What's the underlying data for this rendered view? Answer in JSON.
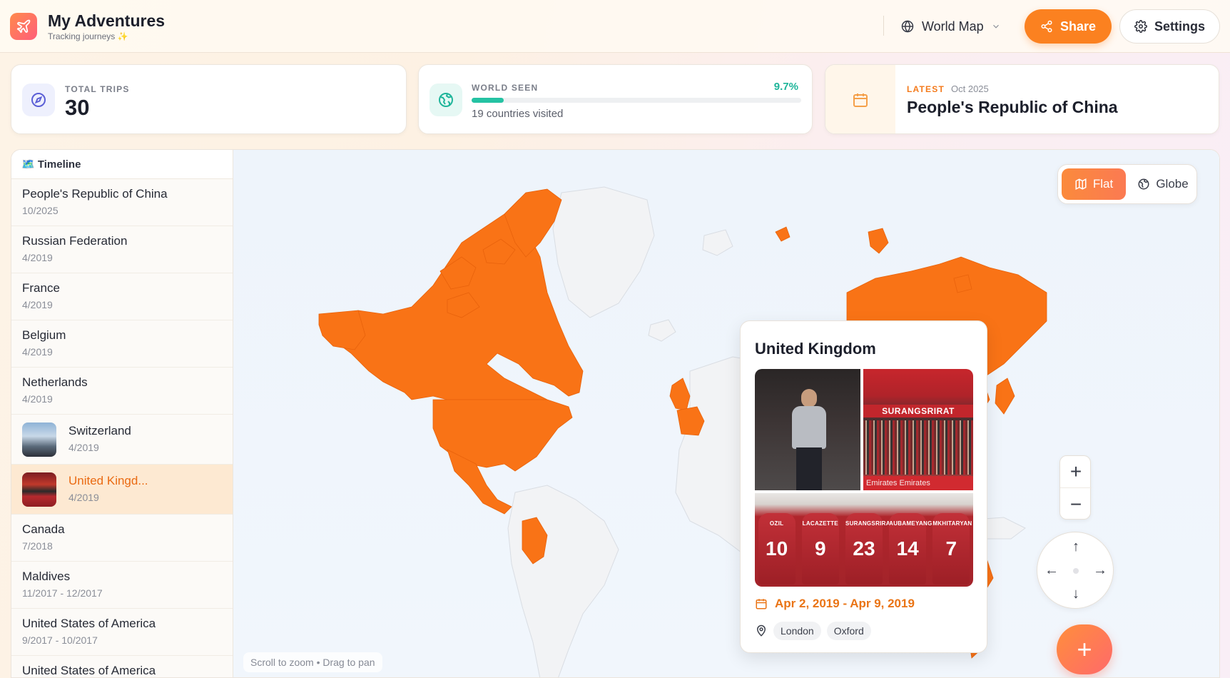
{
  "header": {
    "app_title": "My Adventures",
    "app_subtitle": "Tracking journeys ✨",
    "view_select": "World Map",
    "share_label": "Share",
    "settings_label": "Settings"
  },
  "stats": {
    "total_trips_label": "TOTAL TRIPS",
    "total_trips_value": "30",
    "world_seen_label": "WORLD SEEN",
    "world_seen_pct": "9.7%",
    "world_seen_fraction": 0.097,
    "countries_visited": "19 countries visited",
    "latest_tag": "LATEST",
    "latest_date": "Oct 2025",
    "latest_value": "People's Republic of China"
  },
  "timeline": {
    "title": "🗺️ Timeline",
    "items": [
      {
        "name": "People's Republic of China",
        "date": "10/2025"
      },
      {
        "name": "Russian Federation",
        "date": "4/2019"
      },
      {
        "name": "France",
        "date": "4/2019"
      },
      {
        "name": "Belgium",
        "date": "4/2019"
      },
      {
        "name": "Netherlands",
        "date": "4/2019"
      },
      {
        "name": "Switzerland",
        "date": "4/2019"
      },
      {
        "name": "United Kingd...",
        "date": "4/2019"
      },
      {
        "name": "Canada",
        "date": "7/2018"
      },
      {
        "name": "Maldives",
        "date": "11/2017 - 12/2017"
      },
      {
        "name": "United States of America",
        "date": "9/2017 - 10/2017"
      },
      {
        "name": "United States of America",
        "date": ""
      }
    ]
  },
  "map": {
    "flat_label": "Flat",
    "globe_label": "Globe",
    "zoom_in": "+",
    "zoom_out": "−",
    "pan_up": "↑",
    "pan_down": "↓",
    "pan_left": "←",
    "pan_right": "→",
    "add_button": "+",
    "hint": "Scroll to zoom • Drag to pan",
    "visited_color": "#f97316",
    "unvisited_color": "#f2f3f5"
  },
  "popup": {
    "title": "United Kingdom",
    "dates": "Apr 2, 2019 - Apr 9, 2019",
    "places": [
      "London",
      "Oxford"
    ],
    "photo_banner": "SURANGSRIRAT",
    "photo_adboard": "Emirates    Emirates",
    "kits": [
      {
        "name": "OZIL",
        "number": "10"
      },
      {
        "name": "LACAZETTE",
        "number": "9"
      },
      {
        "name": "SURANGSRIRAT",
        "number": "23"
      },
      {
        "name": "AUBAMEYANG",
        "number": "14"
      },
      {
        "name": "MKHITARYAN",
        "number": "7"
      }
    ]
  },
  "colors": {
    "accent": "#fb8120",
    "teal": "#25c2a3",
    "active_row": "#fde9d2"
  }
}
